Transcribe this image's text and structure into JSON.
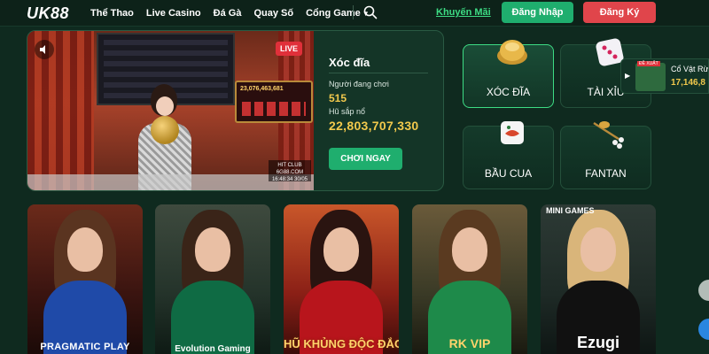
{
  "header": {
    "logo_text": "UK88",
    "nav": [
      {
        "label": "Thể Thao"
      },
      {
        "label": "Live Casino"
      },
      {
        "label": "Đá Gà"
      },
      {
        "label": "Quay Số"
      },
      {
        "label": "Cổng Game",
        "has_dropdown": true
      }
    ],
    "search_icon": "search-icon",
    "promo_link": "Khuyến Mãi",
    "login_label": "Đăng Nhập",
    "register_label": "Đăng Ký",
    "colors": {
      "accent": "#3ddc84",
      "login_bg": "#1fae6e",
      "register_bg": "#e0454b"
    }
  },
  "hero": {
    "live_badge": "LIVE",
    "game_name": "Xóc đĩa",
    "players_label": "Người đang chơi",
    "players_value": "515",
    "jackpot_label": "Hũ sắp nổ",
    "jackpot_value": "22,803,707,330",
    "play_button": "CHƠI NGAY",
    "screen_score": "23,076,463,681",
    "club_tag": "HIT CLUB 6G88.COM 16:48:34 30/05",
    "colors": {
      "highlight": "#f2c94c"
    }
  },
  "tiles": [
    {
      "label": "XÓC ĐĨA",
      "icon": "bowl-icon",
      "active": true
    },
    {
      "label": "TÀI XỈU",
      "icon": "dice-icon"
    },
    {
      "label": "BẦU CUA",
      "icon": "dice-crab-icon"
    },
    {
      "label": "FANTAN",
      "icon": "beads-icon"
    }
  ],
  "side_card": {
    "badge": "ĐỀ XUẤT",
    "name": "Cổ Vật Rừ",
    "amount": "17,146,8"
  },
  "providers": [
    {
      "brand": "PRAGMATIC PLAY"
    },
    {
      "brand": "Evolution Gaming"
    },
    {
      "brand": "HŨ KHỦNG ĐỘC ĐẮC"
    },
    {
      "brand": "RK VIP"
    },
    {
      "brand": "Ezugi",
      "mini_label": "MINI GAMES"
    }
  ]
}
